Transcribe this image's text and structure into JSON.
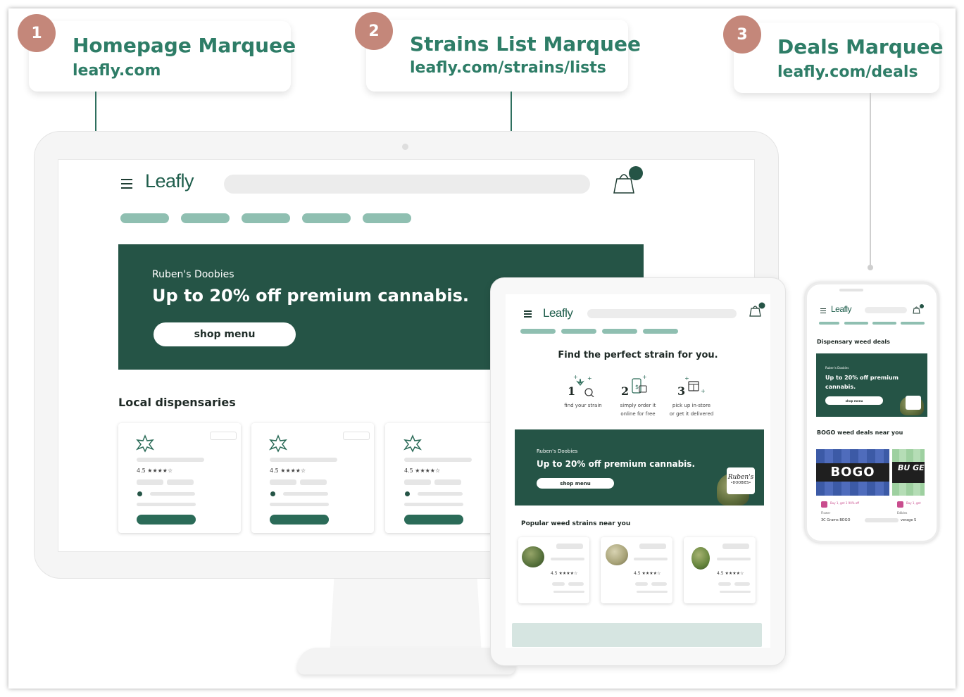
{
  "callouts": [
    {
      "num": "1",
      "title": "Homepage Marquee",
      "url": "leafly.com"
    },
    {
      "num": "2",
      "title": "Strains List Marquee",
      "url": "leafly.com/strains/lists"
    },
    {
      "num": "3",
      "title": "Deals Marquee",
      "url": "leafly.com/deals"
    }
  ],
  "colors": {
    "brand_green": "#255446",
    "accent": "#2e7d67",
    "badge": "#c4877a",
    "tab_pill": "#8fbfb1"
  },
  "desktop": {
    "logo": "Leafly",
    "banner": {
      "brand": "Ruben's Doobies",
      "headline": "Up to 20% off premium cannabis.",
      "cta": "shop menu"
    },
    "section_title": "Local dispensaries",
    "cards": [
      {
        "rating": "4.5 ★★★★☆"
      },
      {
        "rating": "4.5 ★★★★☆"
      },
      {
        "rating": "4.5 ★★★★☆"
      }
    ]
  },
  "tablet": {
    "logo": "Leafly",
    "heading": "Find the perfect strain for you.",
    "steps": [
      {
        "num": "1",
        "line1": "find your strain",
        "line2": ""
      },
      {
        "num": "2",
        "line1": "simply order it",
        "line2": "online for free"
      },
      {
        "num": "3",
        "line1": "pick up in-store",
        "line2": "or get it delivered"
      }
    ],
    "banner": {
      "brand": "Ruben's Doobies",
      "headline": "Up to 20% off premium cannabis.",
      "cta": "shop menu",
      "logo_line1": "Ruben's",
      "logo_line2": "•DOOBIES•"
    },
    "section_title": "Popular weed strains near you",
    "cards": [
      {
        "rating": "4.5 ★★★★☆"
      },
      {
        "rating": "4.5 ★★★★☆"
      },
      {
        "rating": "4.5 ★★★★☆"
      }
    ]
  },
  "phone": {
    "logo": "Leafly",
    "section1": "Dispensary weed deals",
    "banner": {
      "brand": "Ruben's Doobies",
      "headline": "Up to 20% off premium cannabis.",
      "cta": "shop menu"
    },
    "section2": "BOGO weed deals near you",
    "deal1": {
      "image_text": "BOGO",
      "tag": "Buy 1, get 1 90% off",
      "category": "Flower",
      "name": "3C Grams BOGO"
    },
    "deal2": {
      "image_text": "BU GE",
      "tag": "Buy 1, get",
      "category": "Edibles",
      "name": "verage S"
    }
  }
}
